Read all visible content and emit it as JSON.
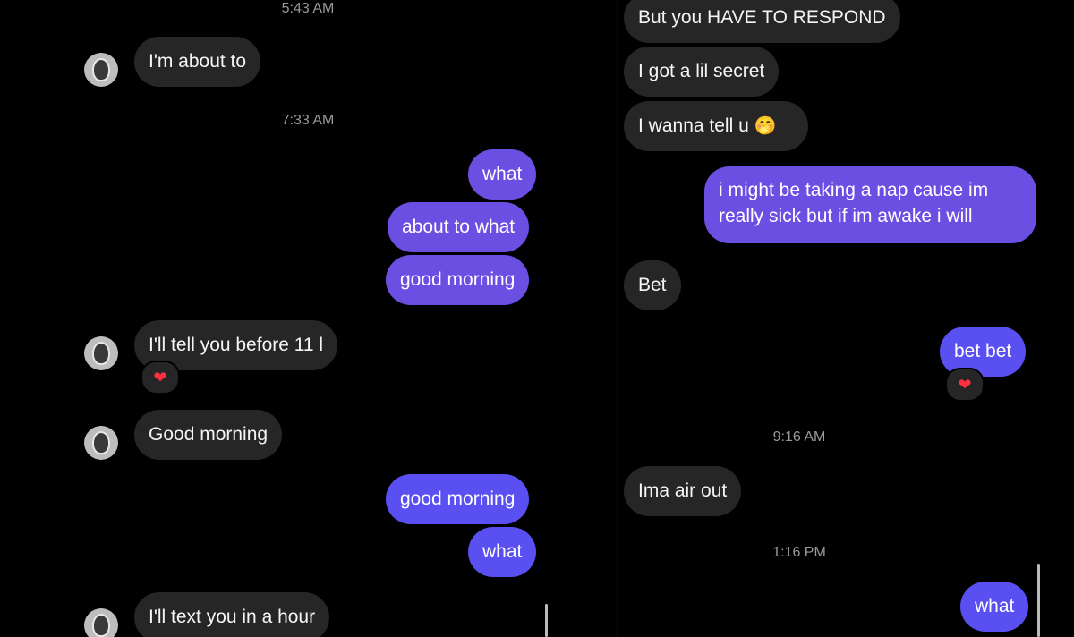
{
  "left": {
    "timestamps": [
      "5:43 AM",
      "7:33 AM"
    ],
    "messages": [
      "I'm about to",
      "what",
      "about to what",
      "good morning",
      "I'll tell you before 11 l",
      "Good morning",
      "good morning",
      "what",
      "I'll text you in a hour"
    ],
    "reaction": "❤"
  },
  "right": {
    "timestamps": [
      "9:16 AM",
      "1:16 PM"
    ],
    "messages": [
      "But you HAVE TO RESPOND",
      "I got a lil secret",
      "I wanna tell u",
      "i might be taking a nap cause im really sick but if im awake i will",
      "Bet",
      "bet bet",
      "Ima air out",
      "what"
    ],
    "emoji": "🤭",
    "reaction": "❤"
  },
  "colors": {
    "background": "#000000",
    "incoming_bubble": "#262626",
    "outgoing_bubble": "#6b4fe3",
    "timestamp_text": "#9a9a9a",
    "reaction_heart": "#ff3040"
  },
  "icons": {
    "avatar": "profile-avatar",
    "reaction": "heart-reaction-icon"
  }
}
